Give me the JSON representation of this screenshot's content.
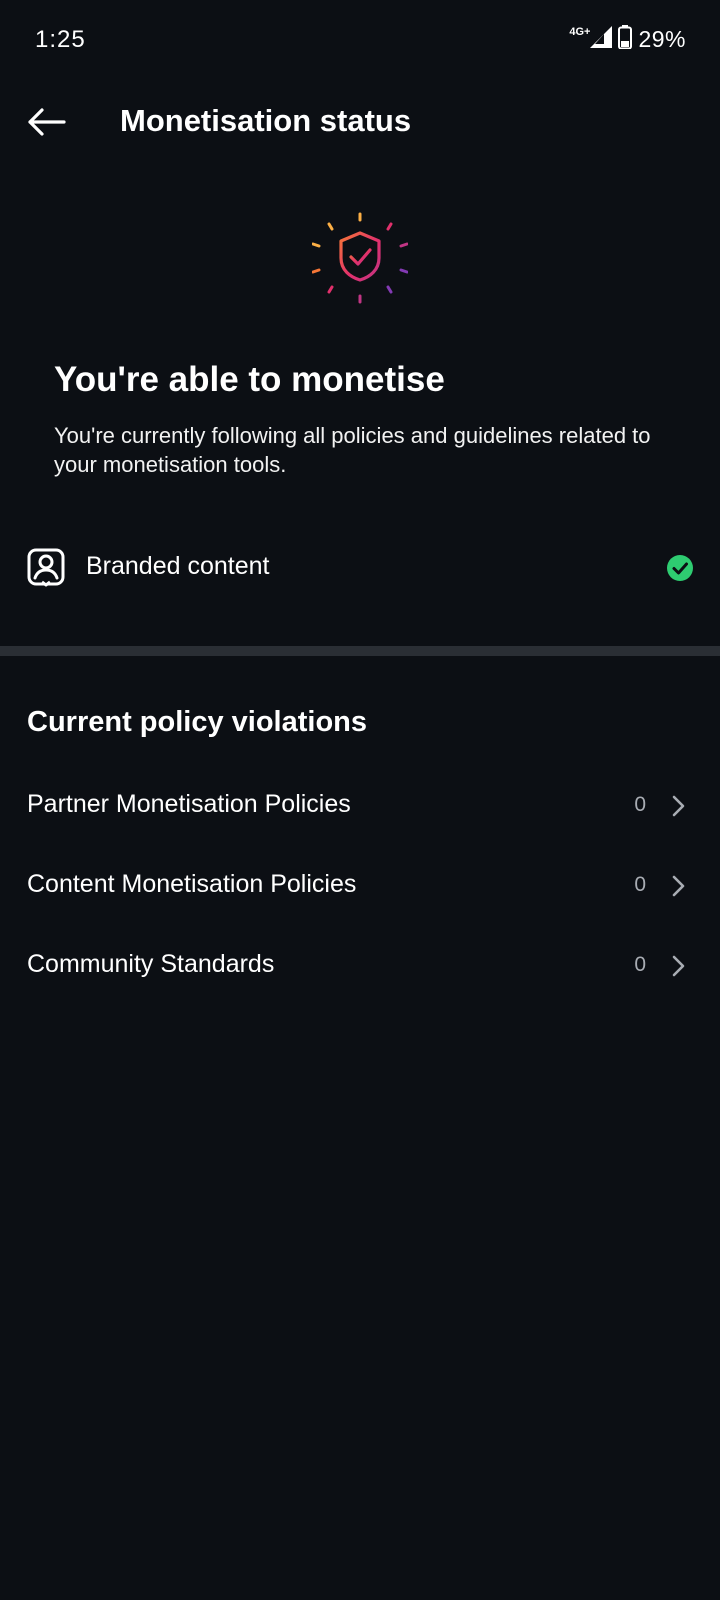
{
  "status_bar": {
    "time": "1:25",
    "network": "4G+",
    "battery": "29%"
  },
  "header": {
    "title": "Monetisation status"
  },
  "hero": {
    "icon": "shield-check-icon",
    "title": "You're able to monetise",
    "description": "You're currently following all policies and guidelines related to your monetisation tools."
  },
  "branded": {
    "icon": "branded-content-icon",
    "label": "Branded content",
    "status": "eligible",
    "status_color": "#2ecc71"
  },
  "violations": {
    "title": "Current policy violations",
    "items": [
      {
        "label": "Partner Monetisation Policies",
        "count": "0"
      },
      {
        "label": "Content Monetisation Policies",
        "count": "0"
      },
      {
        "label": "Community Standards",
        "count": "0"
      }
    ]
  },
  "colors": {
    "background": "#0c0f14",
    "divider": "#2a2e34",
    "muted_text": "#a8acb3"
  }
}
